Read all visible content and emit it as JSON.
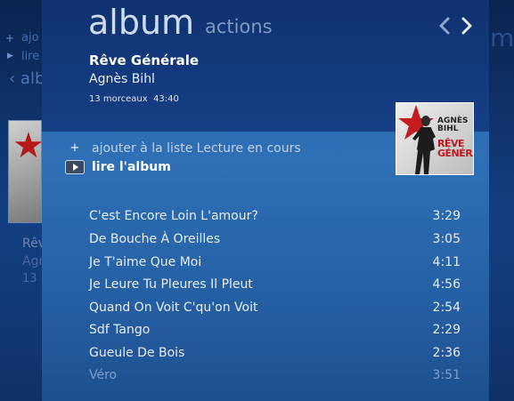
{
  "background": {
    "add_fragment": "ajo",
    "play_fragment": "lire",
    "album_fragment": "alb",
    "right_fragment": "m",
    "title_fragment": "Rêv",
    "artist_fragment": "Agn",
    "meta_fragment": "13"
  },
  "pivot": {
    "active": "album",
    "inactive": "actions"
  },
  "album": {
    "title": "Rêve Générale",
    "artist": "Agnès Bihl",
    "track_count": "13 morceaux",
    "duration": "43:40",
    "cover_artist_line1": "AGNÈS",
    "cover_artist_line2": "BIHL",
    "cover_album_line1": "RÊVE",
    "cover_album_line2": "GÉNÉRALE"
  },
  "actions": {
    "add_to_queue": "ajouter à la liste Lecture en cours",
    "play_album": "lire l'album"
  },
  "tracks": [
    {
      "title": "C'est Encore Loin L'amour?",
      "duration": "3:29"
    },
    {
      "title": "De Bouche À Oreilles",
      "duration": "3:05"
    },
    {
      "title": "Je T'aime Que Moi",
      "duration": "4:11"
    },
    {
      "title": "Je Leure Tu Pleures Il Pleut",
      "duration": "4:56"
    },
    {
      "title": "Quand On Voit C'qu'on Voit",
      "duration": "2:54"
    },
    {
      "title": "Sdf Tango",
      "duration": "2:29"
    },
    {
      "title": "Gueule De Bois",
      "duration": "2:36"
    },
    {
      "title": "Véro",
      "duration": "3:51"
    }
  ],
  "icons": {
    "previous": "chevron-left-icon",
    "next": "chevron-right-icon",
    "add": "plus-icon",
    "play": "play-icon"
  },
  "colors": {
    "header": "#133a7d",
    "panel": "#2e6fb6",
    "text": "#ffffff"
  }
}
